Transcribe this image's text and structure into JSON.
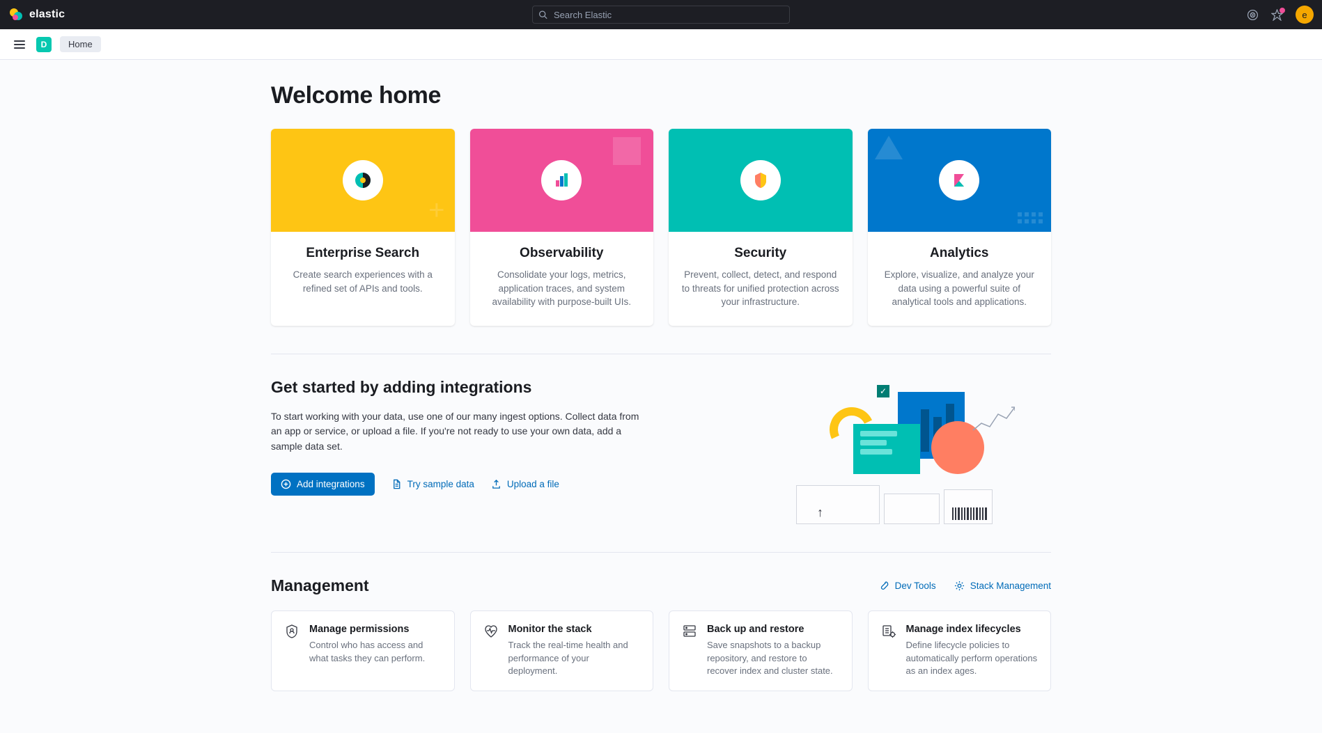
{
  "header": {
    "brand": "elastic",
    "search_placeholder": "Search Elastic",
    "avatar_initial": "e"
  },
  "subheader": {
    "space_initial": "D",
    "breadcrumb": "Home"
  },
  "page": {
    "title": "Welcome home"
  },
  "solutions": [
    {
      "title": "Enterprise Search",
      "desc": "Create search experiences with a refined set of APIs and tools.",
      "color": "yellow"
    },
    {
      "title": "Observability",
      "desc": "Consolidate your logs, metrics, application traces, and system availability with purpose-built UIs.",
      "color": "pink"
    },
    {
      "title": "Security",
      "desc": "Prevent, collect, detect, and respond to threats for unified protection across your infrastructure.",
      "color": "teal"
    },
    {
      "title": "Analytics",
      "desc": "Explore, visualize, and analyze your data using a powerful suite of analytical tools and applications.",
      "color": "blue"
    }
  ],
  "getstarted": {
    "title": "Get started by adding integrations",
    "desc": "To start working with your data, use one of our many ingest options. Collect data from an app or service, or upload a file. If you're not ready to use your own data, add a sample data set.",
    "add_btn": "Add integrations",
    "sample_link": "Try sample data",
    "upload_link": "Upload a file"
  },
  "management": {
    "title": "Management",
    "dev_tools": "Dev Tools",
    "stack_mgmt": "Stack Management",
    "cards": [
      {
        "title": "Manage permissions",
        "desc": "Control who has access and what tasks they can perform."
      },
      {
        "title": "Monitor the stack",
        "desc": "Track the real-time health and performance of your deployment."
      },
      {
        "title": "Back up and restore",
        "desc": "Save snapshots to a backup repository, and restore to recover index and cluster state."
      },
      {
        "title": "Manage index lifecycles",
        "desc": "Define lifecycle policies to automatically perform operations as an index ages."
      }
    ]
  }
}
